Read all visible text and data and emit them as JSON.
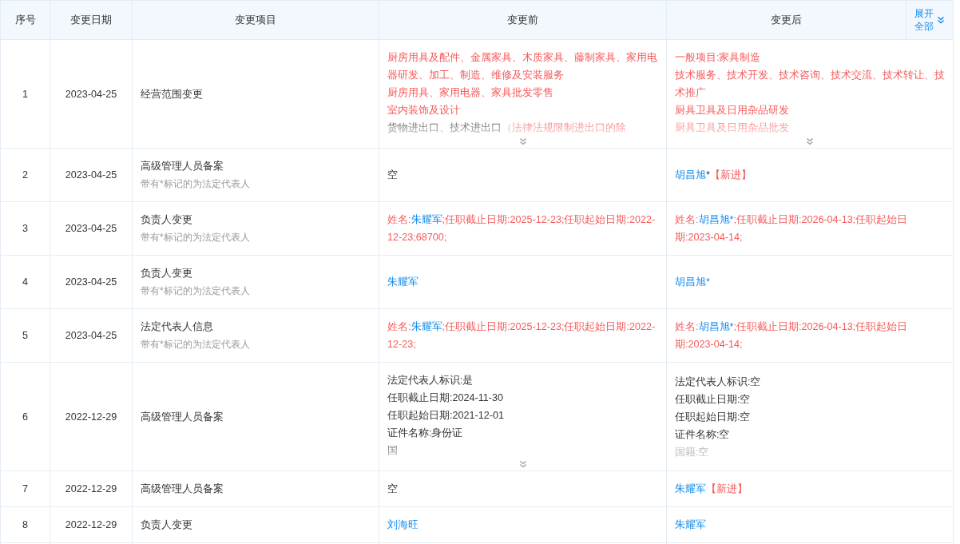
{
  "table": {
    "columns": [
      "序号",
      "变更日期",
      "变更项目",
      "变更前",
      "变更后"
    ],
    "expand_all": {
      "label_lines": [
        "展开",
        "全部"
      ],
      "expanded": false
    },
    "rows": [
      {
        "index": "1",
        "date": "2023-04-25",
        "item": "经营范围变更",
        "before": {
          "collapsed": true,
          "lines": [
            [
              {
                "kind": "changed",
                "text": "厨房用具及配件、金属家具、木质家具、藤制家具、家用电器研发、加工、制造、维修及安装服务"
              }
            ],
            [
              {
                "kind": "changed",
                "text": "厨房用具、家用电器、家具批发零售"
              }
            ],
            [
              {
                "kind": "changed",
                "text": "室内装饰及设计"
              }
            ],
            [
              {
                "kind": "plain",
                "text": "货物进出口、技术进出口"
              },
              {
                "kind": "changed",
                "text": "（法律法规限制进出口的除"
              }
            ]
          ]
        },
        "after": {
          "collapsed": true,
          "lines": [
            [
              {
                "kind": "changed",
                "text": "一般项目:家具制造"
              }
            ],
            [
              {
                "kind": "changed",
                "text": "技术服务、技术开发、技术咨询、技术交流、技术转让、技术推广"
              }
            ],
            [
              {
                "kind": "changed",
                "text": "厨具卫具及日用杂品研发"
              }
            ],
            [
              {
                "kind": "changed",
                "text": "厨具卫具及日用杂品批发"
              }
            ]
          ]
        }
      },
      {
        "index": "2",
        "date": "2023-04-25",
        "item": "高级管理人员备案",
        "note": "带有*标记的为法定代表人",
        "before": {
          "collapsed": false,
          "lines": [
            [
              {
                "kind": "plain",
                "text": "空"
              }
            ]
          ]
        },
        "after": {
          "collapsed": false,
          "lines": [
            [
              {
                "kind": "person",
                "text": "胡昌旭"
              },
              {
                "kind": "plain",
                "text": "*"
              },
              {
                "kind": "changed",
                "text": "【新进】"
              }
            ]
          ]
        }
      },
      {
        "index": "3",
        "date": "2023-04-25",
        "item": "负责人变更",
        "note": "带有*标记的为法定代表人",
        "before": {
          "collapsed": false,
          "lines": [
            [
              {
                "kind": "changed",
                "text": "姓名:"
              },
              {
                "kind": "person",
                "text": "朱耀军"
              },
              {
                "kind": "changed",
                "text": ";任职截止日期:2025-12-23;任职起始日期:2022-12-23;68700;"
              }
            ]
          ]
        },
        "after": {
          "collapsed": false,
          "lines": [
            [
              {
                "kind": "changed",
                "text": "姓名:"
              },
              {
                "kind": "person",
                "text": "胡昌旭*"
              },
              {
                "kind": "changed",
                "text": ";任职截止日期:2026-04-13;任职起始日期:2023-04-14;"
              }
            ]
          ]
        }
      },
      {
        "index": "4",
        "date": "2023-04-25",
        "item": "负责人变更",
        "note": "带有*标记的为法定代表人",
        "before": {
          "collapsed": false,
          "lines": [
            [
              {
                "kind": "person",
                "text": "朱耀军"
              }
            ]
          ]
        },
        "after": {
          "collapsed": false,
          "lines": [
            [
              {
                "kind": "person",
                "text": "胡昌旭*"
              }
            ]
          ]
        }
      },
      {
        "index": "5",
        "date": "2023-04-25",
        "item": "法定代表人信息",
        "note": "带有*标记的为法定代表人",
        "before": {
          "collapsed": false,
          "lines": [
            [
              {
                "kind": "changed",
                "text": "姓名:"
              },
              {
                "kind": "person",
                "text": "朱耀军"
              },
              {
                "kind": "changed",
                "text": ";任职截止日期:2025-12-23;任职起始日期:2022-12-23;"
              }
            ]
          ]
        },
        "after": {
          "collapsed": false,
          "lines": [
            [
              {
                "kind": "changed",
                "text": "姓名:"
              },
              {
                "kind": "person",
                "text": "胡昌旭*"
              },
              {
                "kind": "changed",
                "text": ";任职截止日期:2026-04-13;任职起始日期:2023-04-14;"
              }
            ]
          ]
        }
      },
      {
        "index": "6",
        "date": "2022-12-29",
        "item": "高级管理人员备案",
        "before": {
          "collapsed": true,
          "lines": [
            [
              {
                "kind": "plain",
                "text": "法定代表人标识:是"
              }
            ],
            [
              {
                "kind": "plain",
                "text": "任职截止日期:2024-11-30"
              }
            ],
            [
              {
                "kind": "plain",
                "text": "任职起始日期:2021-12-01"
              }
            ],
            [
              {
                "kind": "plain",
                "text": "证件名称:身份证"
              }
            ],
            [
              {
                "kind": "plain",
                "text": "国"
              }
            ]
          ]
        },
        "after": {
          "collapsed": false,
          "lines": [
            [
              {
                "kind": "plain",
                "text": "法定代表人标识:空"
              }
            ],
            [
              {
                "kind": "plain",
                "text": "任职截止日期:空"
              }
            ],
            [
              {
                "kind": "plain",
                "text": "任职起始日期:空"
              }
            ],
            [
              {
                "kind": "plain",
                "text": "证件名称:空"
              }
            ],
            [
              {
                "kind": "plain",
                "text": "国籍:空"
              }
            ]
          ],
          "faded_last": true
        }
      },
      {
        "index": "7",
        "date": "2022-12-29",
        "item": "高级管理人员备案",
        "before": {
          "collapsed": false,
          "lines": [
            [
              {
                "kind": "plain",
                "text": "空"
              }
            ]
          ]
        },
        "after": {
          "collapsed": false,
          "lines": [
            [
              {
                "kind": "person",
                "text": "朱耀军"
              },
              {
                "kind": "changed",
                "text": "【新进】"
              }
            ]
          ]
        }
      },
      {
        "index": "8",
        "date": "2022-12-29",
        "item": "负责人变更",
        "before": {
          "collapsed": false,
          "lines": [
            [
              {
                "kind": "person",
                "text": "刘海旺"
              }
            ]
          ]
        },
        "after": {
          "collapsed": false,
          "lines": [
            [
              {
                "kind": "person",
                "text": "朱耀军"
              }
            ]
          ]
        }
      }
    ]
  }
}
